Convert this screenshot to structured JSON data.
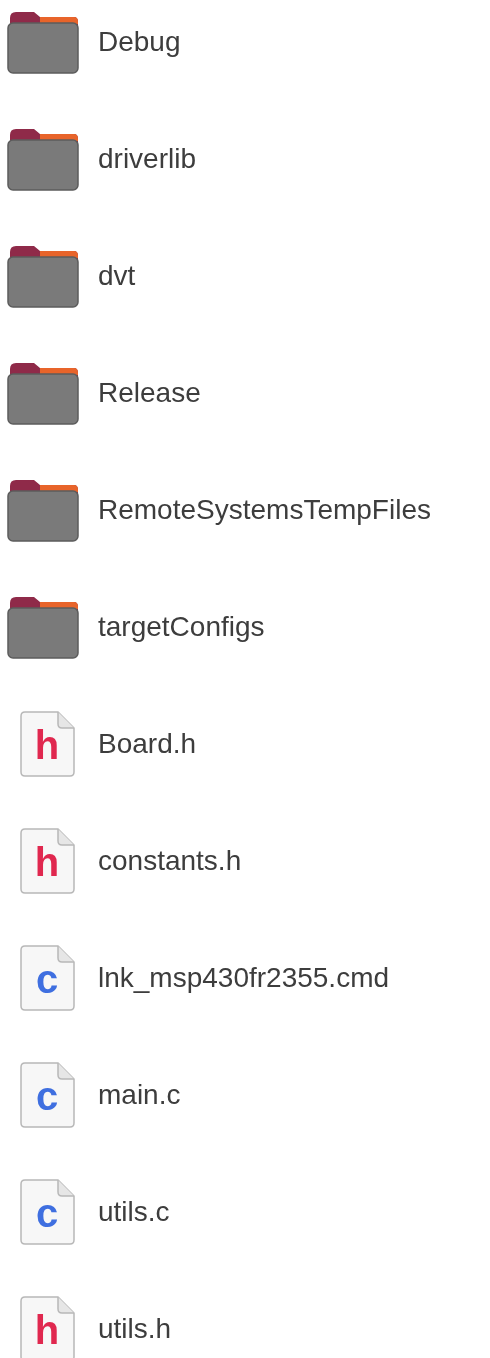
{
  "files": [
    {
      "name": "Debug",
      "kind": "folder"
    },
    {
      "name": "driverlib",
      "kind": "folder"
    },
    {
      "name": "dvt",
      "kind": "folder"
    },
    {
      "name": "Release",
      "kind": "folder"
    },
    {
      "name": "RemoteSystemsTempFiles",
      "kind": "folder"
    },
    {
      "name": "targetConfigs",
      "kind": "folder"
    },
    {
      "name": "Board.h",
      "kind": "header",
      "icon_letter": "h"
    },
    {
      "name": "constants.h",
      "kind": "header",
      "icon_letter": "h"
    },
    {
      "name": "lnk_msp430fr2355.cmd",
      "kind": "source",
      "icon_letter": "c"
    },
    {
      "name": "main.c",
      "kind": "source",
      "icon_letter": "c"
    },
    {
      "name": "utils.c",
      "kind": "source",
      "icon_letter": "c"
    },
    {
      "name": "utils.h",
      "kind": "header",
      "icon_letter": "h"
    }
  ]
}
